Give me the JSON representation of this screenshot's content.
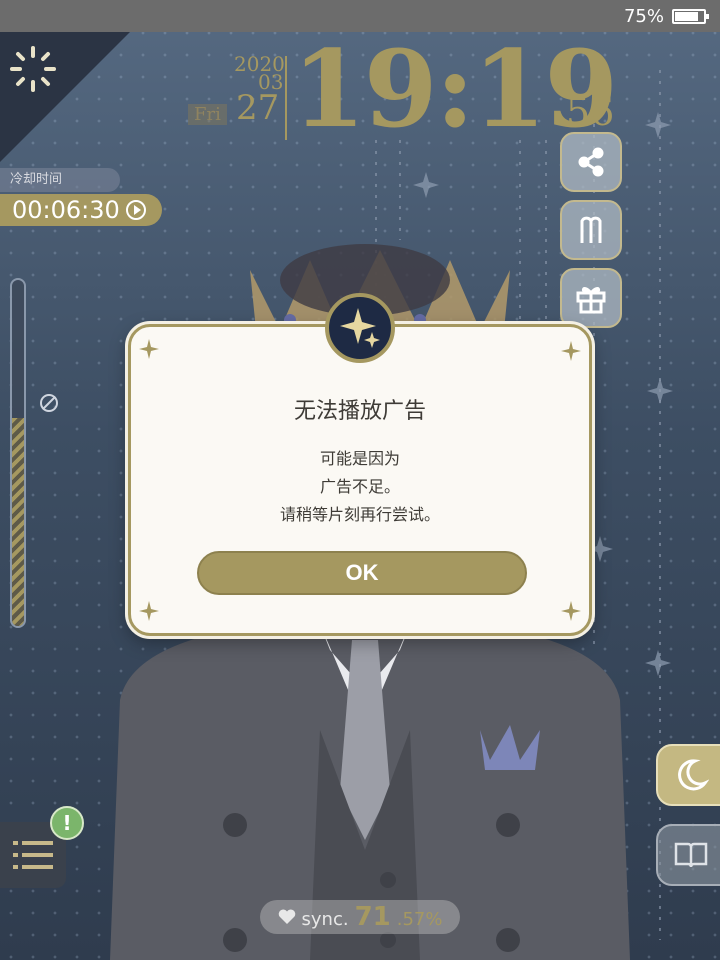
{
  "status_bar": {
    "battery_percent": "75%",
    "battery_level": 0.75
  },
  "clock": {
    "year": "2020",
    "month": "03",
    "day": "27",
    "weekday": "Fri",
    "time": "19:19",
    "seconds": "56"
  },
  "cooldown": {
    "label": "冷却时间",
    "timer": "00:06:30"
  },
  "gauge": {
    "level": 0.6
  },
  "side_buttons": [
    "share-icon",
    "character-icon",
    "gift-icon"
  ],
  "dialog": {
    "title": "无法播放广告",
    "message_lines": [
      "可能是因为",
      "广告不足。",
      "请稍等片刻再行尝试。"
    ],
    "ok_label": "OK"
  },
  "bottom": {
    "sync_label": "sync.",
    "sync_int": "71",
    "sync_frac": ".57%",
    "alert_mark": "!"
  },
  "colors": {
    "gold": "#a59860",
    "dialog_bg": "#fbf9f4",
    "background": "#3c4a5c"
  }
}
